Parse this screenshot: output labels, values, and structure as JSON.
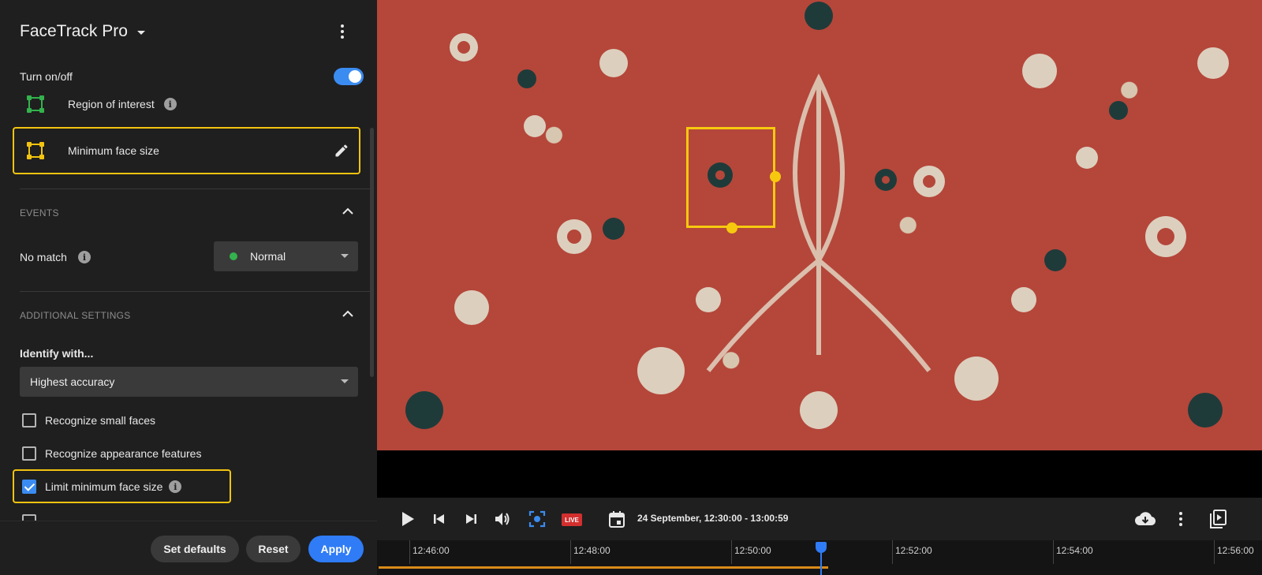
{
  "panel": {
    "app_title": "FaceTrack Pro",
    "turn_on_off_label": "Turn on/off",
    "toggle_on": true,
    "region_of_interest_label": "Region of interest",
    "minimum_face_size_label": "Minimum face size",
    "events": {
      "title": "EVENTS",
      "no_match_label": "No match",
      "no_match_value": "Normal"
    },
    "additional": {
      "title": "ADDITIONAL SETTINGS",
      "identify_label": "Identify with...",
      "identify_value": "Highest accuracy",
      "options": [
        {
          "label": "Recognize small faces",
          "checked": false
        },
        {
          "label": "Recognize appearance features",
          "checked": false
        },
        {
          "label": "Limit minimum face size",
          "checked": true
        }
      ]
    },
    "footer": {
      "set_defaults": "Set defaults",
      "reset": "Reset",
      "apply": "Apply"
    }
  },
  "controls": {
    "live_badge": "LIVE",
    "date_range": "24 September, 12:30:00 - 13:00:59"
  },
  "timeline": {
    "labels": [
      "12:46:00",
      "12:48:00",
      "12:50:00",
      "12:52:00",
      "12:54:00",
      "12:56:00"
    ]
  },
  "colors": {
    "accent_blue": "#2f7cf6",
    "highlight_yellow": "#f2c40f",
    "status_green": "#33b24d",
    "live_red": "#d32f2f",
    "progress_orange": "#d98b1a"
  }
}
